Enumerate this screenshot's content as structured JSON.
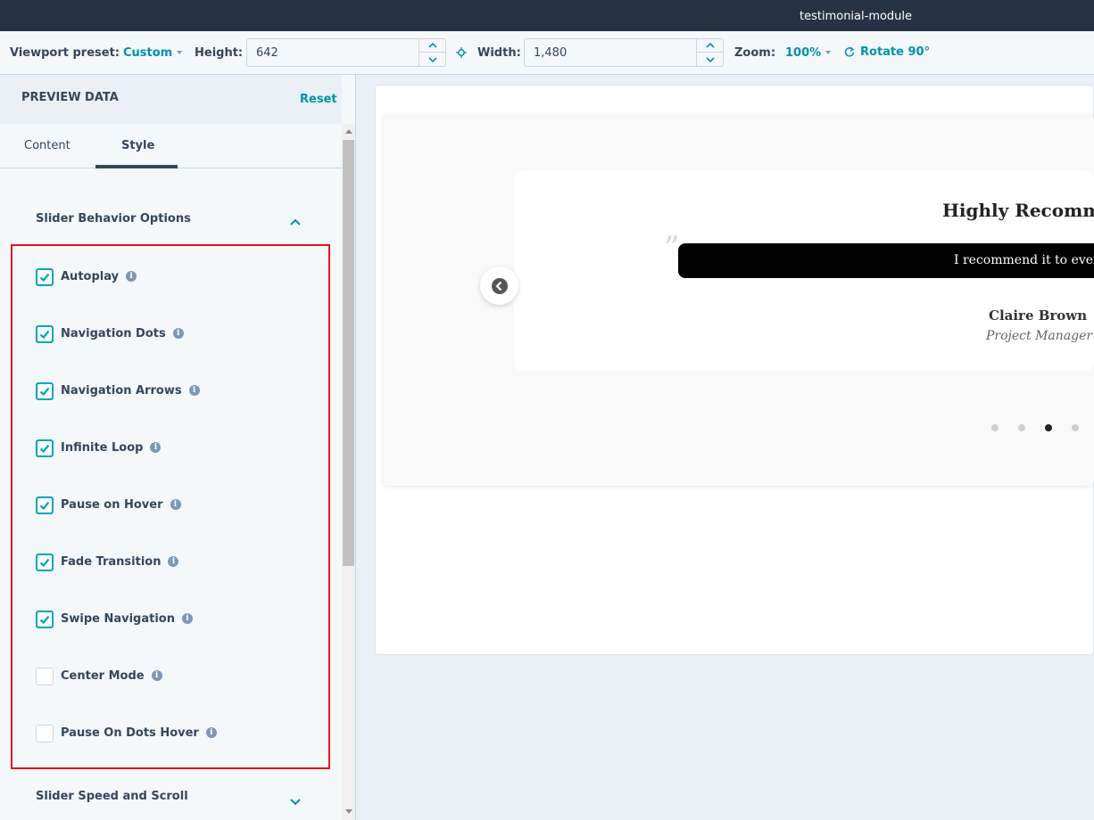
{
  "app": {
    "title": "testimonial-module"
  },
  "toolbar": {
    "viewport_label": "Viewport preset:",
    "viewport_value": "Custom",
    "height_label": "Height:",
    "height_value": "642",
    "width_label": "Width:",
    "width_value": "1,480",
    "zoom_label": "Zoom:",
    "zoom_value": "100%",
    "rotate_label": "Rotate 90°"
  },
  "panel": {
    "title": "PREVIEW DATA",
    "reset_label": "Reset",
    "tabs": [
      {
        "label": "Content",
        "active": false
      },
      {
        "label": "Style",
        "active": true
      }
    ],
    "section_behavior": {
      "title": "Slider Behavior Options",
      "expanded": true,
      "options": [
        {
          "label": "Autoplay",
          "checked": true
        },
        {
          "label": "Navigation Dots",
          "checked": true
        },
        {
          "label": "Navigation Arrows",
          "checked": true
        },
        {
          "label": "Infinite Loop",
          "checked": true
        },
        {
          "label": "Pause on Hover",
          "checked": true
        },
        {
          "label": "Fade Transition",
          "checked": true
        },
        {
          "label": "Swipe Navigation",
          "checked": true
        },
        {
          "label": "Center Mode",
          "checked": false
        },
        {
          "label": "Pause On Dots Hover",
          "checked": false
        }
      ]
    },
    "section_speed": {
      "title": "Slider Speed and Scroll",
      "expanded": false
    }
  },
  "preview": {
    "testimonial_title": "Highly Recommen",
    "testimonial_text": "I recommend it to everyo",
    "quote_mark": "”",
    "author_name": "Claire Brown",
    "author_role": "Project Manager",
    "dots": [
      false,
      false,
      true,
      false
    ]
  },
  "colors": {
    "accent": "#0091ae",
    "checkbox": "#00a4bd",
    "highlight": "#e5141b",
    "titlebar": "#253342"
  }
}
